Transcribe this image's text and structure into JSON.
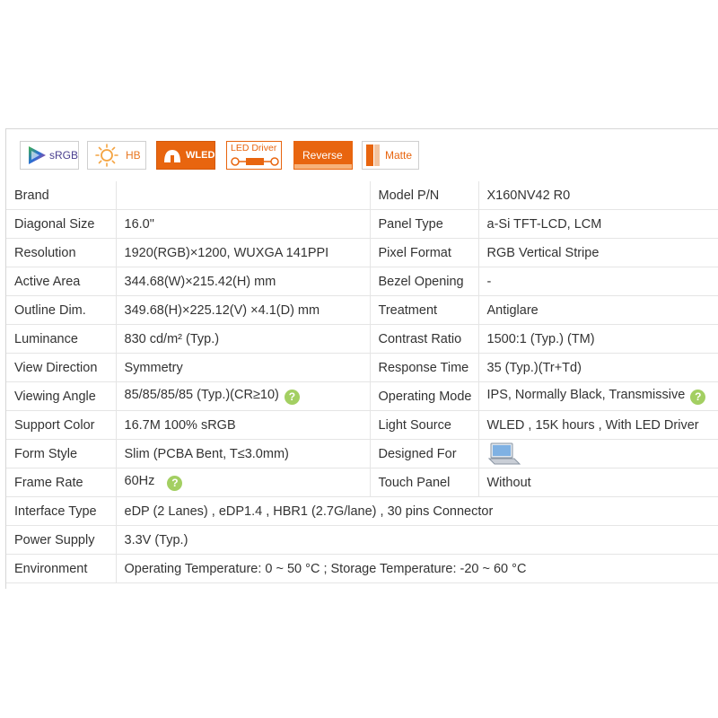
{
  "badges": [
    {
      "label": "sRGB",
      "icon": "color-gamut-icon"
    },
    {
      "label": "HB",
      "icon": "sun-icon"
    },
    {
      "label": "WLED",
      "icon": "led-icon"
    },
    {
      "label": "LED Driver",
      "icon": "led-driver-icon"
    },
    {
      "label": "Reverse",
      "icon": "reverse-icon"
    },
    {
      "label": "Matte",
      "icon": "matte-icon"
    }
  ],
  "colors": {
    "accent": "#e8650f",
    "link": "#1f4e8c",
    "help": "#a3cf62",
    "grid": "#e5e5e5"
  },
  "rows": [
    {
      "k1": "Brand",
      "v1": "",
      "k2": "Model P/N",
      "v2": "X160NV42 R0"
    },
    {
      "k1": "Diagonal Size",
      "v1": "16.0\"",
      "k2": "Panel Type",
      "v2": "a-Si TFT-LCD, LCM"
    },
    {
      "k1": "Resolution",
      "v1": "1920(RGB)×1200, WUXGA  141PPI",
      "k2": "Pixel Format",
      "v2": "RGB Vertical Stripe"
    },
    {
      "k1": "Active Area",
      "v1": "344.68(W)×215.42(H) mm",
      "k2": "Bezel Opening",
      "v2": "-"
    },
    {
      "k1": "Outline Dim.",
      "v1": "349.68(H)×225.12(V) ×4.1(D) mm",
      "k2": "Treatment",
      "v2": "Antiglare"
    },
    {
      "k1": "Luminance",
      "v1": "830 cd/m² (Typ.)",
      "k2": "Contrast Ratio",
      "v2": "1500:1 (Typ.) (TM)"
    },
    {
      "k1": "View Direction",
      "v1": "Symmetry",
      "k2": "Response Time",
      "v2": "35 (Typ.)(Tr+Td)"
    },
    {
      "k1": "Viewing Angle",
      "v1": "85/85/85/85 (Typ.)(CR≥10)",
      "k2": "Operating Mode",
      "v2": "IPS, Normally Black, Transmissive"
    },
    {
      "k1": "Support Color",
      "v1": "16.7M   100% sRGB",
      "k2": "Light Source",
      "v2": "WLED , 15K hours , With LED Driver"
    },
    {
      "k1": "Form Style",
      "v1": "Slim (PCBA Bent, T≤3.0mm)",
      "k2": "Designed For",
      "v2": ""
    },
    {
      "k1": "Frame Rate",
      "v1": "60Hz",
      "k2": "Touch Panel",
      "v2": "Without"
    },
    {
      "k1": "Interface Type",
      "v1": "eDP (2 Lanes) , eDP1.4 , HBR1 (2.7G/lane) , 30 pins Connector"
    },
    {
      "k1": "Power Supply",
      "v1": "3.3V (Typ.)"
    },
    {
      "k1": "Environment",
      "v1": "Operating Temperature: 0 ~ 50 °C ; Storage Temperature: -20 ~ 60 °C"
    }
  ],
  "help_glyph": "?"
}
